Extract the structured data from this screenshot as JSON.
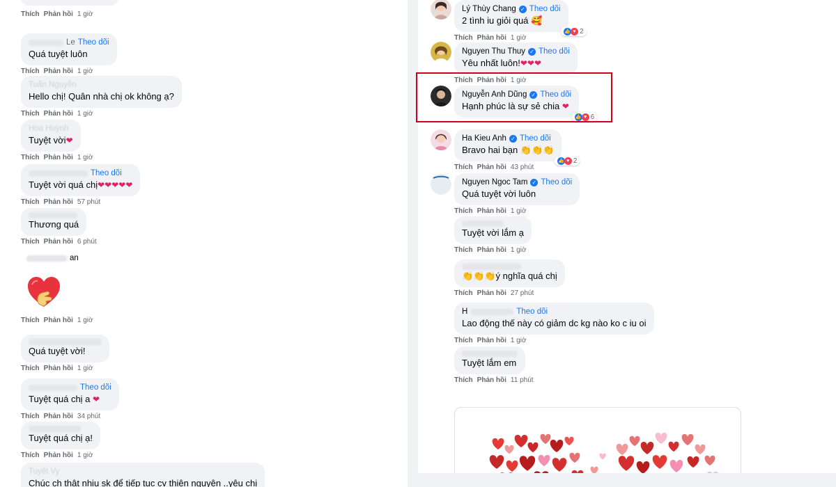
{
  "labels": {
    "like": "Thích",
    "reply": "Phản hồi",
    "follow": "Theo dõi"
  },
  "left": {
    "c0": {
      "time": "1 giờ"
    },
    "c1": {
      "name_fragment": "Le",
      "text": "Quá tuyệt luôn",
      "time": "1 giờ"
    },
    "c2": {
      "name": "Tuấn Nguyễn",
      "text": "Hello chị! Quân nhà chị ok không ạ?",
      "time": "1 giờ"
    },
    "c3": {
      "name": "Hoa Huỳnh",
      "text": "Tuyệt vời",
      "time": "1 giờ"
    },
    "c4": {
      "text": "Tuyệt vời quá chị",
      "time": "57 phút"
    },
    "c5": {
      "text": "Thương quá",
      "time": "6 phút"
    },
    "c6": {
      "name_fragment": "an",
      "time": "1 giờ"
    },
    "c7": {
      "text": "Quá tuyệt vời!",
      "time": "1 giờ"
    },
    "c8": {
      "text": "Tuyệt quá chị a",
      "time": "34 phút"
    },
    "c9": {
      "text": "Tuyệt quá chị ạ!",
      "time": "1 giờ"
    },
    "c10": {
      "name": "Tuyết Vy",
      "text": "Chúc ch thật nhiu sk để tiếp tục cv thiện nguyện ..yêu chị"
    }
  },
  "right": {
    "r1": {
      "name": "Lý Thùy Chang",
      "text": "2 tình iu giỏi quá 🥰",
      "time": "1 giờ",
      "reactions": "2"
    },
    "r2": {
      "name": "Nguyen Thu Thuy",
      "text": "Yêu nhất luôn!",
      "time": "1 giờ"
    },
    "r3": {
      "name": "Nguyễn Anh Dũng",
      "text": "Hạnh phúc là sự sẻ chia",
      "reactions": "6"
    },
    "r4": {
      "name": "Ha Kieu Anh",
      "text": "Bravo hai bạn 👏👏👏",
      "time": "43 phút",
      "reactions": "2"
    },
    "r5": {
      "name": "Nguyen Ngoc Tam",
      "text": "Quá tuyệt vời luôn",
      "time": "1 giờ"
    },
    "r6": {
      "text": "Tuyệt vời lắm ạ",
      "time": "1 giờ"
    },
    "r7": {
      "text": "👏👏👏ý nghĩa quá chị",
      "time": "27 phút"
    },
    "r8": {
      "name_fragment": "H",
      "text": "Lao động thế này có giảm dc kg nào ko c iu oi",
      "time": "1 giờ"
    },
    "r9": {
      "text": "Tuyệt lắm em",
      "time": "11 phút"
    }
  },
  "colors": {
    "accent": "#1877f2",
    "highlight": "#d0021b",
    "heart": "#e0245e",
    "bubble": "#f0f2f5"
  }
}
